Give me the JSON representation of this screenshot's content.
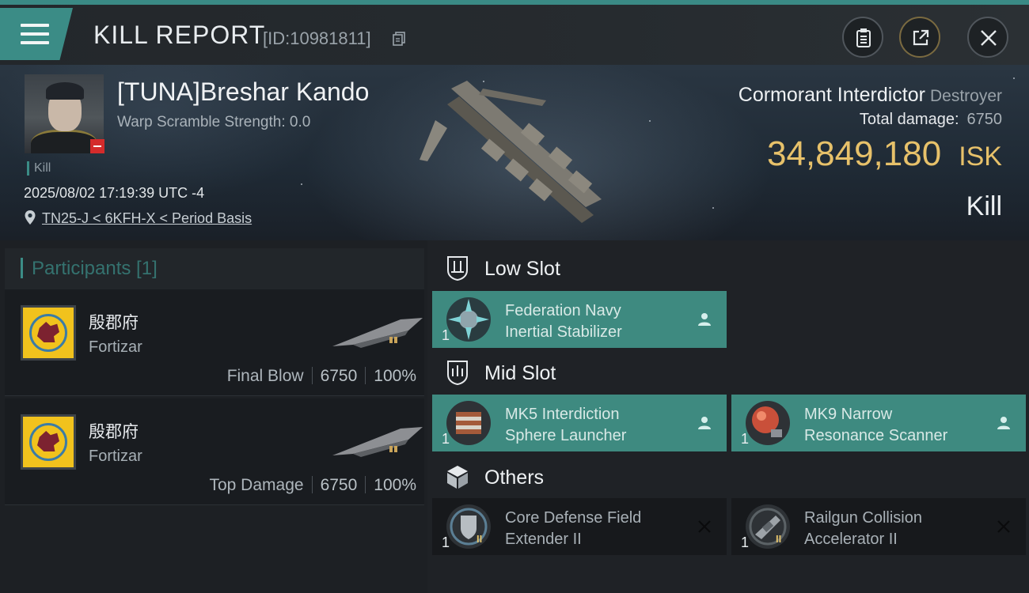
{
  "header": {
    "title": "KILL REPORT",
    "report_id": "[ID:10981811]",
    "buttons": [
      "menu",
      "clipboard",
      "share",
      "close"
    ]
  },
  "victim": {
    "pilot_name": "[TUNA]Breshar Kando",
    "warp_scramble": "Warp Scramble Strength: 0.0",
    "tag": "Kill",
    "timestamp": "2025/08/02 17:19:39 UTC -4",
    "location": "TN25-J < 6KFH-X < Period Basis",
    "ship_name": "Cormorant Interdictor",
    "ship_class": "Destroyer",
    "total_damage_label": "Total damage:",
    "total_damage": "6750",
    "isk_value": "34,849,180",
    "isk_unit": "ISK",
    "result": "Kill",
    "security_badge_color": "#d42b2b"
  },
  "participants": {
    "title": "Participants [1]",
    "rows": [
      {
        "corp_name": "殷郡府",
        "ship": "Fortizar",
        "stat_label": "Final Blow",
        "damage": "6750",
        "percent": "100%"
      },
      {
        "corp_name": "殷郡府",
        "ship": "Fortizar",
        "stat_label": "Top Damage",
        "damage": "6750",
        "percent": "100%"
      }
    ]
  },
  "slots": {
    "low": {
      "label": "Low Slot",
      "modules": [
        {
          "qty": "1",
          "line1": "Federation Navy",
          "line2": "Inertial Stabilizer",
          "state": "dropped",
          "icon": "stabilizer-icon"
        }
      ]
    },
    "mid": {
      "label": "Mid Slot",
      "modules": [
        {
          "qty": "1",
          "line1": "MK5 Interdiction",
          "line2": "Sphere Launcher",
          "state": "dropped",
          "icon": "launcher-icon"
        },
        {
          "qty": "1",
          "line1": "MK9 Narrow",
          "line2": "Resonance Scanner",
          "state": "dropped",
          "icon": "scanner-icon"
        }
      ]
    },
    "others": {
      "label": "Others",
      "modules": [
        {
          "qty": "1",
          "line1": "Core Defense Field",
          "line2": "Extender II",
          "state": "destroyed",
          "tier": "II",
          "icon": "shield-extender-icon"
        },
        {
          "qty": "1",
          "line1": "Railgun Collision",
          "line2": "Accelerator II",
          "state": "destroyed",
          "tier": "II",
          "icon": "rig-icon"
        }
      ]
    }
  },
  "colors": {
    "accent": "#3b8c86",
    "isk": "#e7c16a",
    "module_fitted": "#3e8a80"
  }
}
